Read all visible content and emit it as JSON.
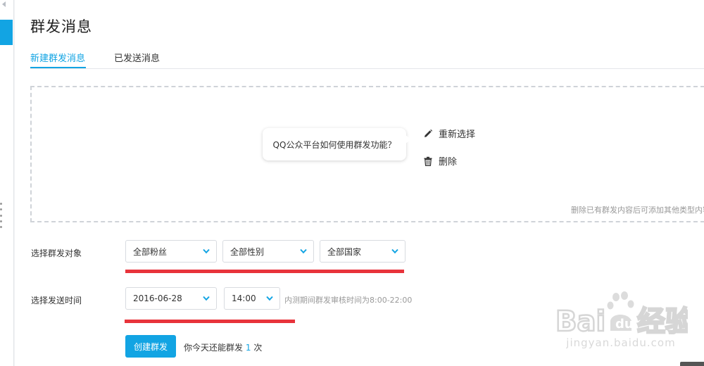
{
  "page": {
    "title": "群发消息"
  },
  "tabs": [
    {
      "label": "新建群发消息",
      "active": true
    },
    {
      "label": "已发送消息",
      "active": false
    }
  ],
  "content": {
    "card_text": "QQ公众平台如何使用群发功能？",
    "reselect_label": "重新选择",
    "delete_label": "删除",
    "hint": "删除已有群发内容后可添加其他类型内容"
  },
  "audience": {
    "label": "选择群发对象",
    "fans": "全部粉丝",
    "gender": "全部性别",
    "country": "全部国家"
  },
  "schedule": {
    "label": "选择发送时间",
    "date": "2016-06-28",
    "time": "14:00",
    "hint": "内测期间群发审核时间为8:00-22:00"
  },
  "footer": {
    "create_button": "创建群发",
    "remaining_prefix": "你今天还能群发",
    "remaining_count": "1",
    "remaining_suffix": "次"
  },
  "watermark": {
    "url": "jingyan.baidu.com"
  },
  "colors": {
    "accent": "#12a4e3",
    "annotation_red": "#e8333b",
    "hint_gray": "#999999"
  },
  "icons": [
    "collapse-arrow-icon",
    "pencil-icon",
    "trash-icon",
    "chevron-down-icon",
    "baidu-paw-icon"
  ]
}
